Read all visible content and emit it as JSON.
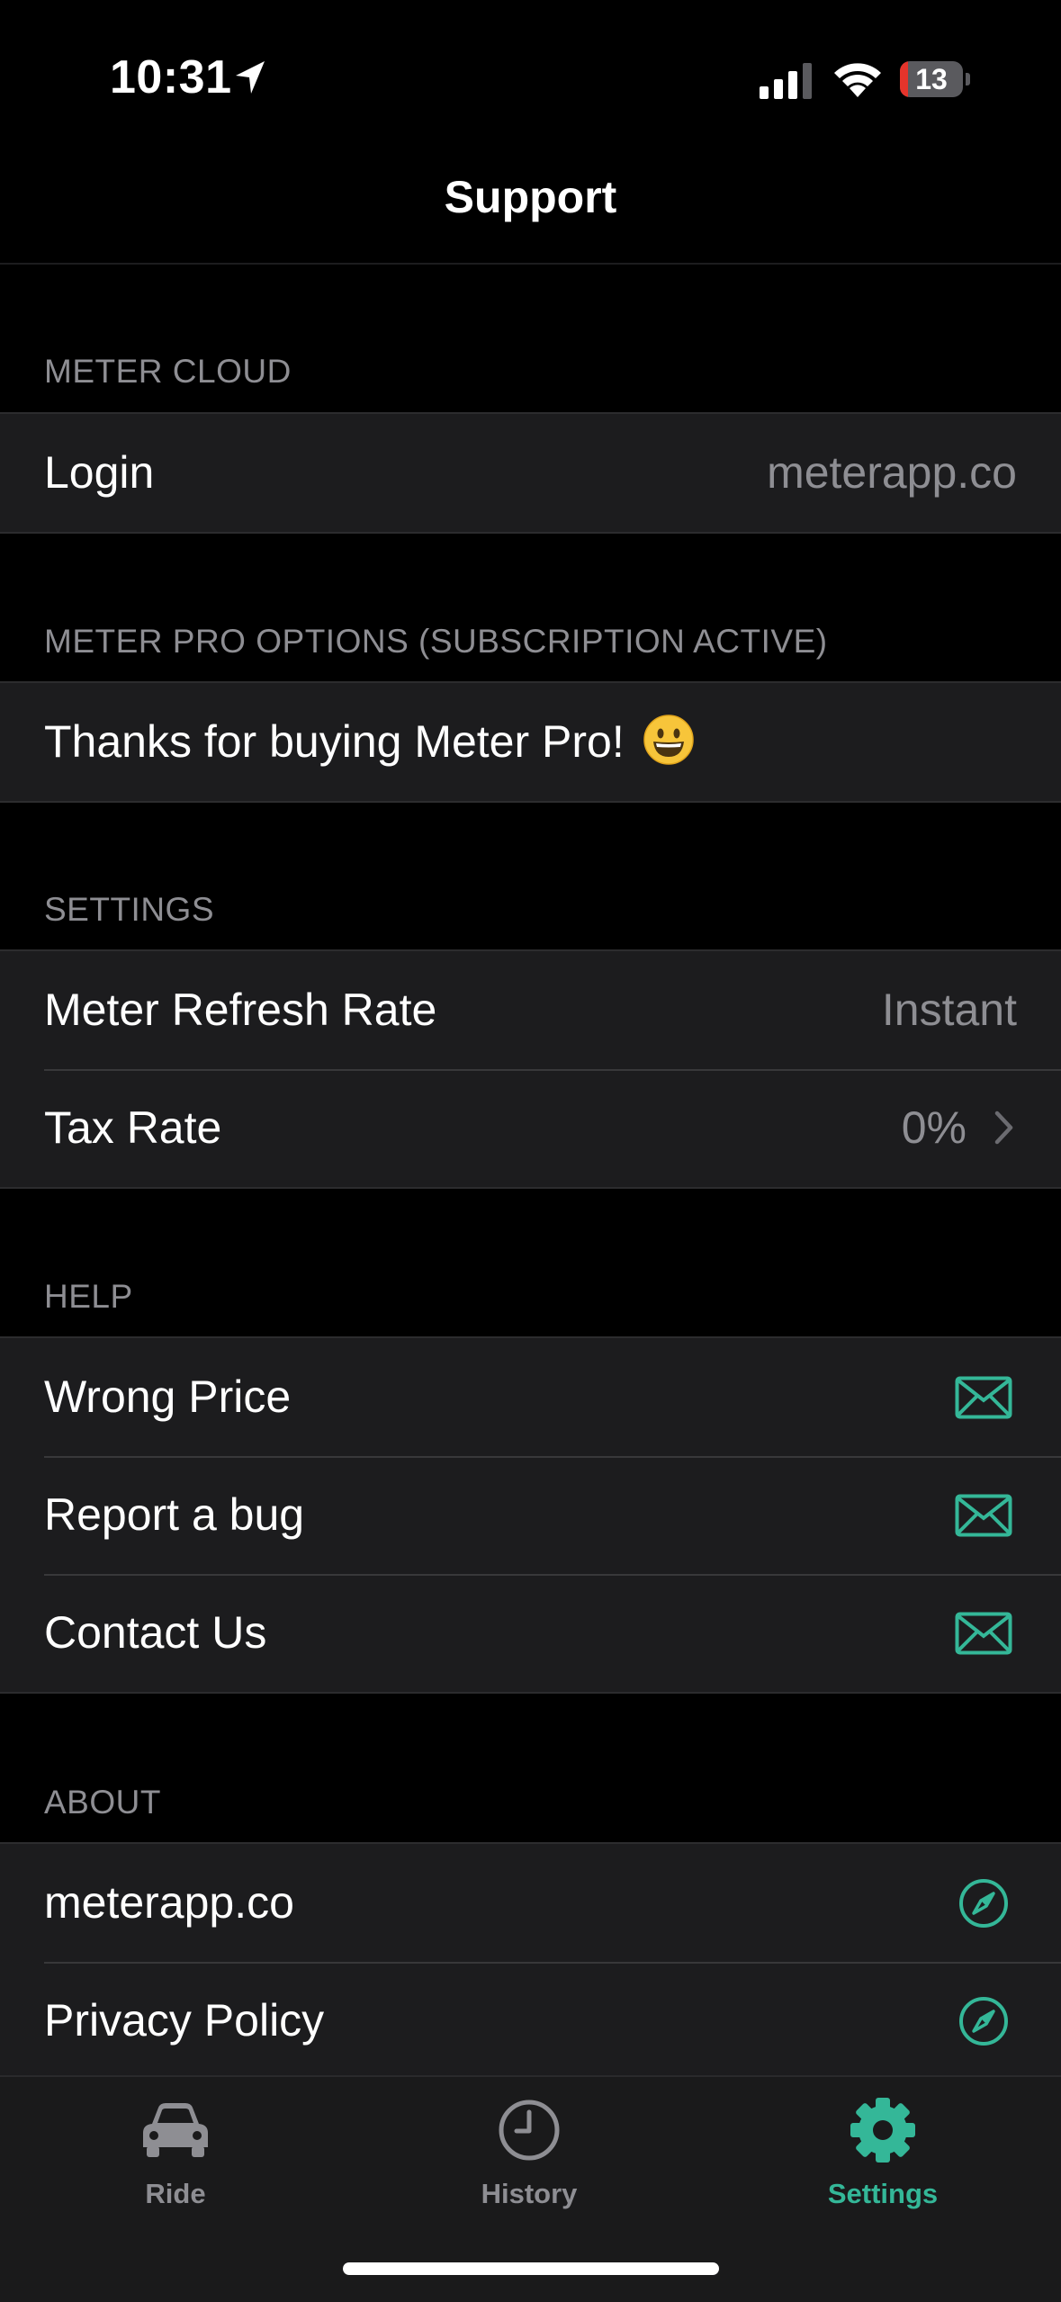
{
  "status_bar": {
    "time": "10:31",
    "battery": "13",
    "battery_level": 0.13
  },
  "nav": {
    "title": "Support"
  },
  "sections": {
    "meter_cloud": {
      "header": "METER CLOUD",
      "login_label": "Login",
      "login_value": "meterapp.co"
    },
    "pro": {
      "header": "METER PRO OPTIONS (SUBSCRIPTION ACTIVE)",
      "thanks_label": "Thanks for buying Meter Pro!"
    },
    "settings": {
      "header": "SETTINGS",
      "refresh_label": "Meter Refresh Rate",
      "refresh_value": "Instant",
      "tax_label": "Tax Rate",
      "tax_value": "0%"
    },
    "help": {
      "header": "HELP",
      "items": [
        {
          "label": "Wrong Price",
          "icon": "envelope-icon"
        },
        {
          "label": "Report a bug",
          "icon": "envelope-icon"
        },
        {
          "label": "Contact Us",
          "icon": "envelope-icon"
        }
      ]
    },
    "about": {
      "header": "ABOUT",
      "items": [
        {
          "label": "meterapp.co",
          "icon": "compass-icon"
        },
        {
          "label": "Privacy Policy",
          "icon": "compass-icon"
        }
      ]
    }
  },
  "tabs": [
    {
      "label": "Ride",
      "icon": "car-icon",
      "active": false
    },
    {
      "label": "History",
      "icon": "clock-icon",
      "active": false
    },
    {
      "label": "Settings",
      "icon": "gear-icon",
      "active": true
    }
  ],
  "colors": {
    "accent": "#34b798",
    "background": "#000000",
    "cell": "#1c1c1e",
    "secondary_text": "#8e8e93"
  }
}
